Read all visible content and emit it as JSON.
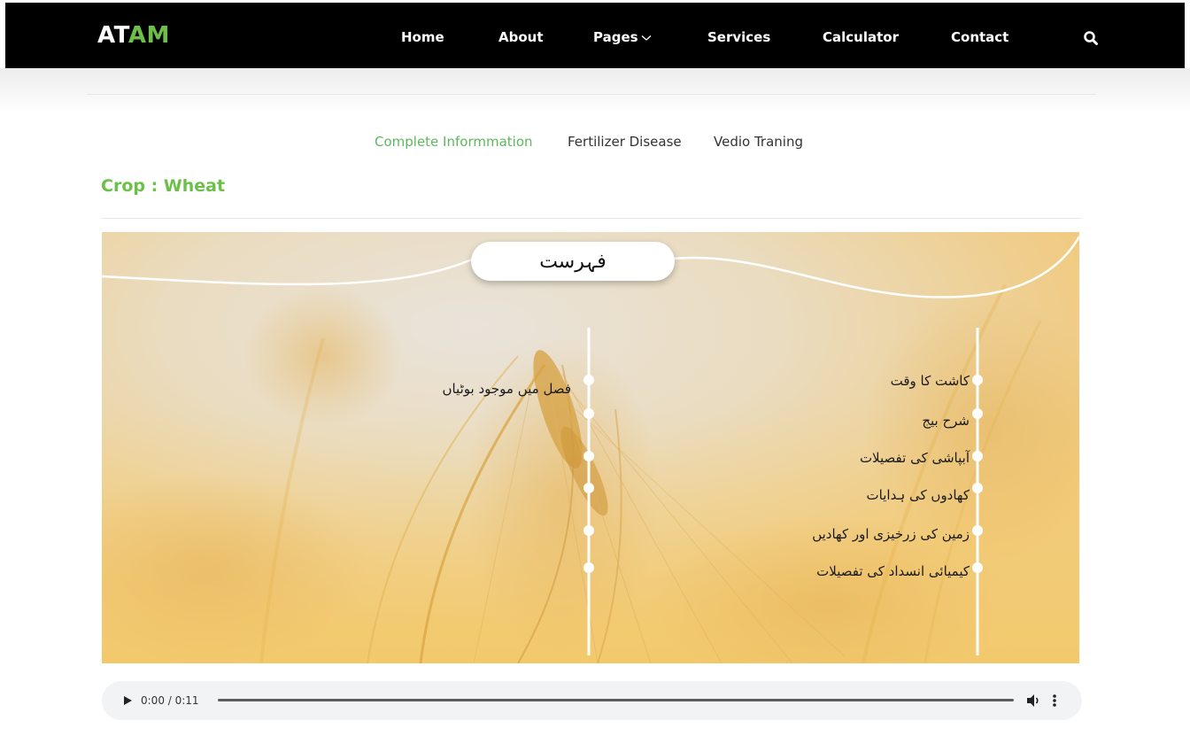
{
  "brand": {
    "logo_part1": "AT",
    "logo_part2": "AM"
  },
  "nav": {
    "items": [
      {
        "label": "Home"
      },
      {
        "label": "About"
      },
      {
        "label": "Pages"
      },
      {
        "label": "Services"
      },
      {
        "label": "Calculator"
      },
      {
        "label": "Contact"
      }
    ],
    "pages_icon": "chevron-down-icon",
    "search_icon": "search-icon"
  },
  "tabs": [
    {
      "label": "Complete Informmation",
      "active": true
    },
    {
      "label": "Fertilizer Disease",
      "active": false
    },
    {
      "label": "Vedio Traning",
      "active": false
    }
  ],
  "crop": {
    "title": "Crop : Wheat"
  },
  "hero": {
    "heading": "فہرست",
    "right_items": [
      "کاشت کا وقت",
      "شرح بیج",
      "آبپاشی کی تفصیلات",
      "کھادوں کی ہدایات",
      "زمین کی زرخیزی اور کھادیں",
      "کیمیائی انسداد کی تفصیلات"
    ],
    "left_items": [
      "فصل میں موجود بوٹیاں"
    ]
  },
  "audio": {
    "time": "0:00 / 0:11",
    "progress": 0,
    "icons": [
      "play-icon",
      "volume-icon",
      "more-vertical-icon"
    ]
  },
  "colors": {
    "navbar_bg": "#000000",
    "brand_accent": "#6cc04a",
    "active_tab": "#5cb85c",
    "audio_bg": "#f1f3f4"
  }
}
